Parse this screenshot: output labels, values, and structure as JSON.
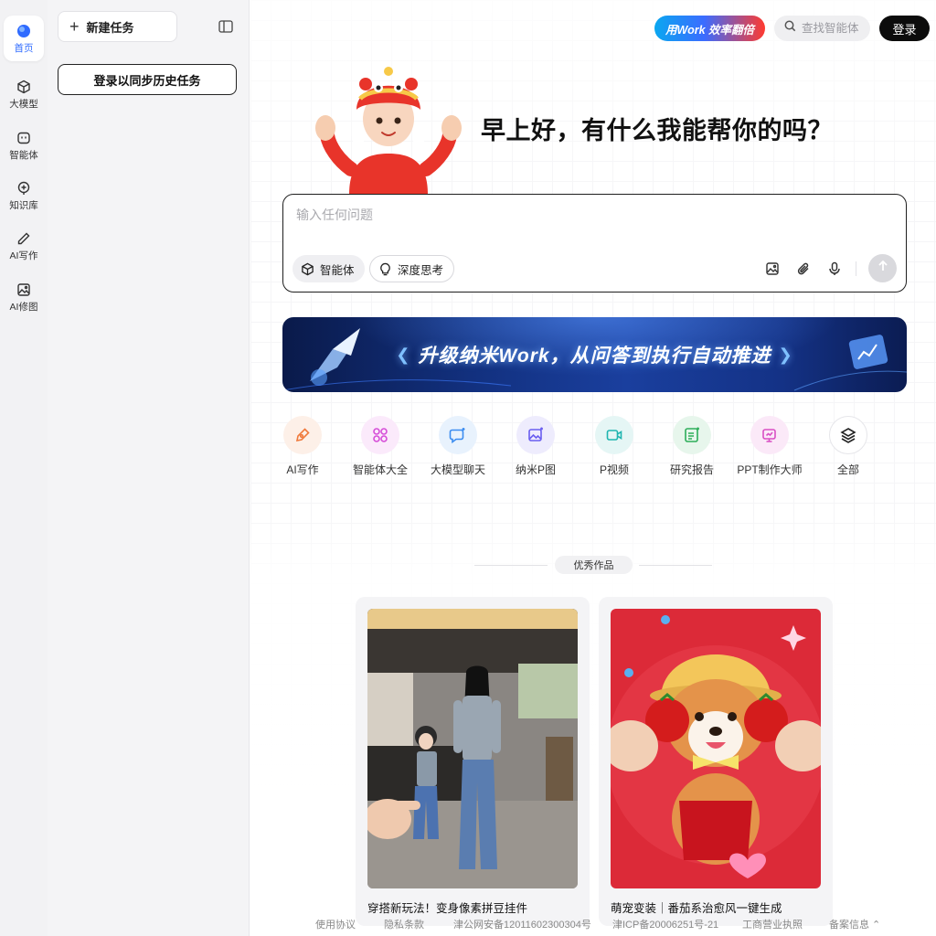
{
  "rail": {
    "items": [
      {
        "label": "首页",
        "icon": "home-icon"
      },
      {
        "label": "大模型",
        "icon": "cube-icon"
      },
      {
        "label": "智能体",
        "icon": "agent-icon"
      },
      {
        "label": "知识库",
        "icon": "knowledge-icon"
      },
      {
        "label": "AI写作",
        "icon": "pen-icon"
      },
      {
        "label": "AI修图",
        "icon": "image-icon"
      }
    ]
  },
  "sidebar": {
    "new_task": "新建任务",
    "login_sync": "登录以同步历史任务"
  },
  "header": {
    "badge": "用Work 效率翻倍",
    "search_placeholder": "查找智能体",
    "login": "登录"
  },
  "hero": {
    "greeting": "早上好，有什么我能帮你的吗？"
  },
  "chat": {
    "placeholder": "输入任何问题",
    "agent_pill": "智能体",
    "think_pill": "深度思考"
  },
  "banner": {
    "text": "升级纳米Work，从问答到执行自动推进"
  },
  "quick_links": [
    {
      "label": "AI写作",
      "icon": "pen-nib-icon",
      "color": "#f07a3c",
      "bg": "#fdf0e8"
    },
    {
      "label": "智能体大全",
      "icon": "grid-icon",
      "color": "#d64ed8",
      "bg": "#fbeafb"
    },
    {
      "label": "大模型聊天",
      "icon": "chat-sparkle-icon",
      "color": "#3b8cf0",
      "bg": "#e8f2fd"
    },
    {
      "label": "纳米P图",
      "icon": "photo-sparkle-icon",
      "color": "#6a5ef0",
      "bg": "#eeecfd"
    },
    {
      "label": "P视频",
      "icon": "video-icon",
      "color": "#1fb5b0",
      "bg": "#e5f6f5"
    },
    {
      "label": "研究报告",
      "icon": "report-icon",
      "color": "#2eae5a",
      "bg": "#e7f6ec"
    },
    {
      "label": "PPT制作大师",
      "icon": "presentation-icon",
      "color": "#d94fc4",
      "bg": "#fbe9f8"
    },
    {
      "label": "全部",
      "icon": "layers-icon",
      "color": "#222222",
      "bg": "#ffffff"
    }
  ],
  "showcase": {
    "title": "优秀作品",
    "cards": [
      {
        "caption": "穿搭新玩法！变身像素拼豆挂件"
      },
      {
        "caption": "萌宠变装｜番茄系治愈风一键生成"
      }
    ]
  },
  "footer": {
    "links": [
      "使用协议",
      "隐私条款",
      "津公网安备12011602300304号",
      "津ICP备20006251号-21",
      "工商营业执照",
      "备案信息 ⌃"
    ]
  }
}
